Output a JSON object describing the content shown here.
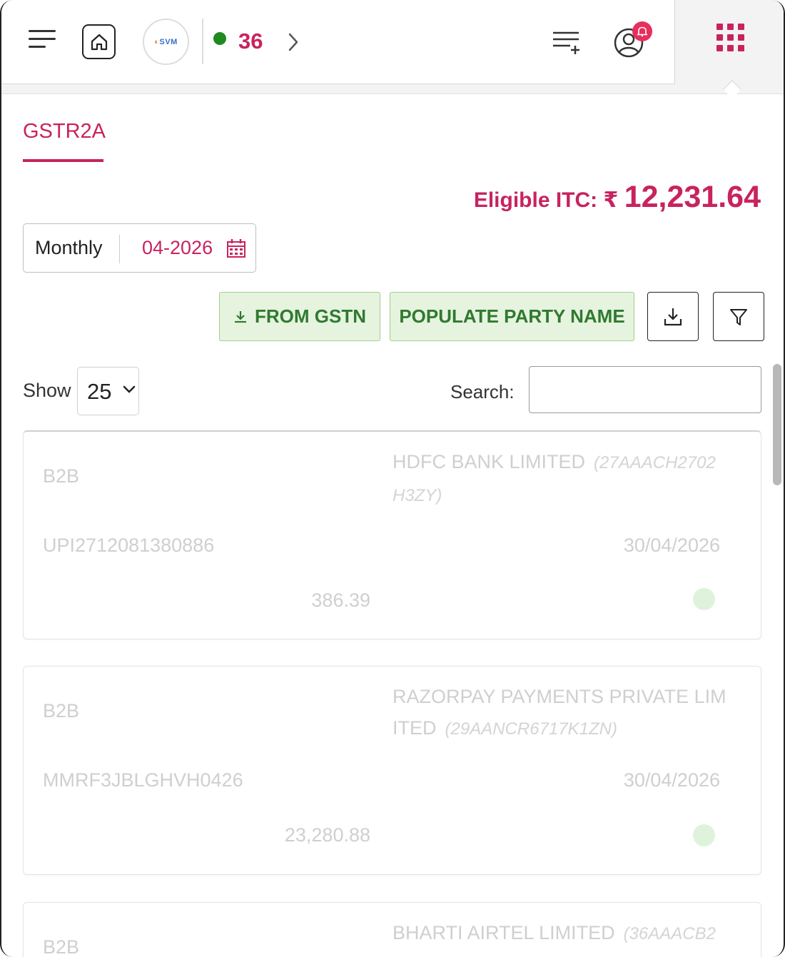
{
  "header": {
    "online_count": "36",
    "logo_text": "SVM",
    "icons": {
      "menu": "menu-icon",
      "home": "home-icon",
      "next": "chevron-right-icon",
      "list_add": "list-add-icon",
      "user_notification": "user-bell-icon",
      "apps": "apps-grid-icon"
    }
  },
  "tabs": [
    {
      "label": "GSTR2A",
      "active": true
    }
  ],
  "itc": {
    "label": "Eligible ITC: ₹",
    "value": "12,231.64"
  },
  "period": {
    "mode": "Monthly",
    "value": "04-2026"
  },
  "actions": {
    "from_gstn": "FROM GSTN",
    "populate_party_name": "POPULATE PARTY NAME"
  },
  "table_controls": {
    "show_label": "Show",
    "page_size": "25",
    "search_label": "Search:",
    "search_value": ""
  },
  "records": [
    {
      "type": "B2B",
      "party": "HDFC BANK LIMITED",
      "gstin": "(27AAACH2702H3ZY)",
      "invoice": "UPI2712081380886",
      "date": "30/04/2026",
      "amount": "386.39",
      "status": "matched"
    },
    {
      "type": "B2B",
      "party": "RAZORPAY PAYMENTS PRIVATE LIMITED",
      "gstin": "(29AANCR6717K1ZN)",
      "invoice": "MMRF3JBLGHVH0426",
      "date": "30/04/2026",
      "amount": "23,280.88",
      "status": "matched"
    },
    {
      "type": "B2B",
      "party": "BHARTI AIRTEL LIMITED",
      "gstin": "(36AAACB2",
      "invoice": "",
      "date": "",
      "amount": "",
      "status": ""
    }
  ],
  "colors": {
    "brand": "#c8235e",
    "green_button_bg": "#e6f3df",
    "green_button_text": "#2f7a2f",
    "online": "#1f8a1f",
    "status_dot": "#dff2dc"
  }
}
